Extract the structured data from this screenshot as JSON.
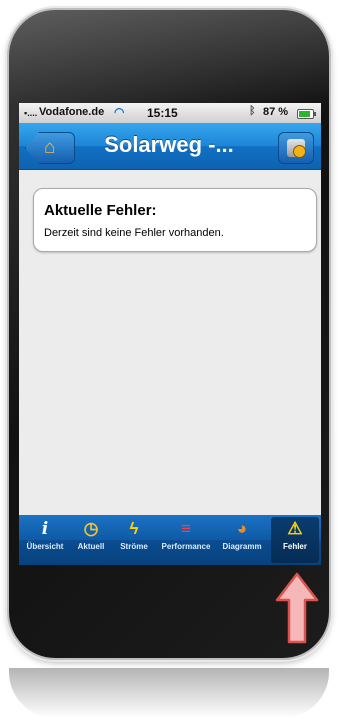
{
  "status_bar": {
    "signal": "▪....",
    "carrier": "Vodafone.de",
    "time": "15:15",
    "battery": "87 %"
  },
  "nav_bar": {
    "title": "Solarweg -...",
    "home_icon": "home-icon",
    "refresh_icon": "refresh-icon"
  },
  "error_card": {
    "title": "Aktuelle Fehler:",
    "message": "Derzeit sind keine Fehler vorhanden."
  },
  "tabs": [
    {
      "label": "Übersicht",
      "icon": "info-icon",
      "active": false
    },
    {
      "label": "Aktuell",
      "icon": "clock-icon",
      "active": false
    },
    {
      "label": "Ströme",
      "icon": "lightning-icon",
      "active": false
    },
    {
      "label": "Performance",
      "icon": "bars-icon",
      "active": false
    },
    {
      "label": "Diagramm",
      "icon": "pie-chart-icon",
      "active": false
    },
    {
      "label": "Fehler",
      "icon": "warning-icon",
      "active": true
    }
  ],
  "colors": {
    "nav_blue": "#1d85d6",
    "tab_blue": "#0a4d91",
    "arrow_pink": "#f5b7b7",
    "arrow_border": "#d9534f"
  }
}
